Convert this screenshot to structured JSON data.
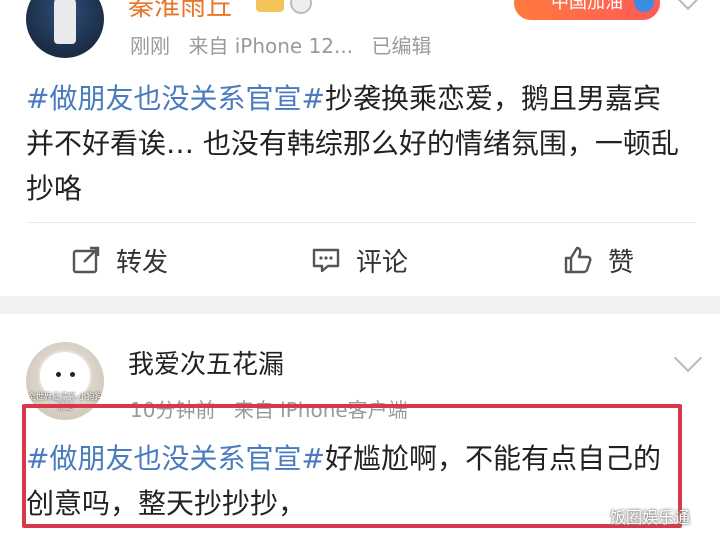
{
  "post1": {
    "username": "秦淮雨丘",
    "badge_label": "中国加油",
    "meta": {
      "time": "刚刚",
      "source": "来自 iPhone 12...",
      "edited": "已编辑"
    },
    "hashtag": "#做朋友也没关系官宣#",
    "text": "抄袭换乘恋爱，鹅且男嘉宾并不好看诶… 也没有韩综那么好的情绪氛围，一顿乱抄咯",
    "actions": {
      "repost": "转发",
      "comment": "评论",
      "like": "赞"
    }
  },
  "post2": {
    "username": "我爱次五花漏",
    "avatar_caption": "全世界最漂亮 小狗狗就是",
    "meta": {
      "time": "10分钟前",
      "source": "来自 iPhone客户端"
    },
    "hashtag": "#做朋友也没关系官宣#",
    "text": "好尴尬啊，不能有点自己的创意吗，整天抄抄抄，"
  },
  "watermark": "饭圈娱乐通",
  "colors": {
    "hashtag": "#4a7bbf",
    "username_orange": "#e8762b",
    "highlight_box": "#d9374b",
    "gap": "#f1f1f1"
  }
}
